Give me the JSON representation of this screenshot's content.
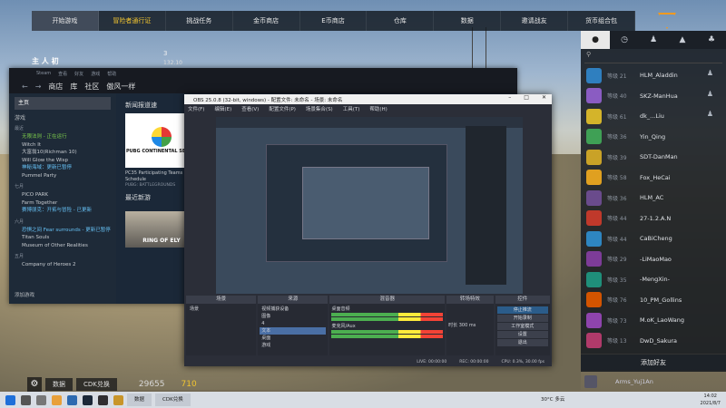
{
  "game_nav": {
    "tabs": [
      "开始游戏",
      "冒险者通行证",
      "挑战任务",
      "金币商店",
      "E币商店",
      "仓库",
      "数据",
      "邀请战友",
      "货币组合包"
    ]
  },
  "hud": {
    "left_label": "主 人 初",
    "top_value": "132.10",
    "top_sub": "3"
  },
  "friends": {
    "tabs": [
      "person-icon",
      "clock-icon",
      "add-person-icon",
      "group-icon",
      "people-icon"
    ],
    "search_placeholder": "",
    "list": [
      {
        "level": "等级 21",
        "name": "HLM_Aladdin",
        "badge": true,
        "color": "#2f7fbf"
      },
      {
        "level": "等级 40",
        "name": "SKZ-ManHua",
        "badge": true,
        "color": "#8a5cc2"
      },
      {
        "level": "等级 61",
        "name": "dk_...Liu",
        "badge": true,
        "color": "#d4b42a"
      },
      {
        "level": "等级 36",
        "name": "Yin_Qing",
        "badge": false,
        "color": "#3fa055"
      },
      {
        "level": "等级 39",
        "name": "SDT-DanMan",
        "badge": false,
        "color": "#c9a227"
      },
      {
        "level": "等级 58",
        "name": "Fox_HeCai",
        "badge": false,
        "color": "#e0a020"
      },
      {
        "level": "等级 36",
        "name": "HLM_AC",
        "badge": false,
        "color": "#6a4b8c"
      },
      {
        "level": "等级 44",
        "name": "27-1.2.A.N",
        "badge": false,
        "color": "#c0392b"
      },
      {
        "level": "等级 44",
        "name": "CaBiCheng",
        "badge": false,
        "color": "#2e86c1"
      },
      {
        "level": "等级 29",
        "name": "-LiMaoMao",
        "badge": false,
        "color": "#7d3c98"
      },
      {
        "level": "等级 35",
        "name": "-MengXin-",
        "badge": false,
        "color": "#1f8f7a"
      },
      {
        "level": "等级 76",
        "name": "10_PM_Gollins",
        "badge": false,
        "color": "#d35400"
      },
      {
        "level": "等级 73",
        "name": "M.oK_LaoWang",
        "badge": false,
        "color": "#8e44ad"
      },
      {
        "level": "等级 13",
        "name": "DwD_Sakura",
        "badge": false,
        "color": "#b03a6a"
      }
    ],
    "add_friend": "添加好友",
    "me_name": "Arms_Yuj1An"
  },
  "game_bottom": {
    "btn1": "数据",
    "btn2": "CDK兑换",
    "coins": "29655",
    "gold": "710"
  },
  "steam": {
    "menu": [
      "Steam",
      "查看",
      "好友",
      "游戏",
      "帮助"
    ],
    "nav": [
      "商店",
      "库",
      "社区",
      "傲风一样"
    ],
    "home": "主页",
    "games_label": "游戏",
    "recent_label": "最近",
    "recent_games": [
      "无限法则 - 正在运行",
      "Witch It",
      "大富翁10(Richman 10)",
      "Will Glow the Wisp",
      "神秘海域：更新已暂停",
      "Pummel Party"
    ],
    "friends_label": "七月",
    "july_games": [
      "PICO PARK",
      "Farm Together",
      "赛博朋克：开拓与冒险 - 已更新"
    ],
    "june_label": "六月",
    "june_games": [
      "恐惧之间 Fear surrounds - 更新已暂停",
      "Titan Souls",
      "Museum of Other Realities"
    ],
    "may_label": "五月",
    "may_games": [
      "Company of Heroes 2"
    ],
    "add_game": "添加游戏",
    "news_header": "新闻报道速",
    "news_text": "PC35 Participating Teams Schedule",
    "news_source": "PUBG: BATTLEGROUNDS",
    "pubg_logo_text": "PUBG CONTINENTAL SERIES",
    "recent_header": "最近新游",
    "ring_text": "RING OF ELY"
  },
  "obs": {
    "title": "OBS 25.0.8 (32-bit, windows) - 配置文件: 未命名 - 场景: 未命名",
    "menu": [
      "文件(F)",
      "编辑(E)",
      "查看(V)",
      "配置文件(P)",
      "场景集合(S)",
      "工具(T)",
      "帮助(H)"
    ],
    "docks": {
      "scenes": "场景",
      "sources": "来源",
      "mixer": "混音器",
      "transitions": "转场特效",
      "controls": "控件"
    },
    "scene_items": [
      "场景"
    ],
    "source_items": [
      "视频捕获设备",
      "图像",
      "4",
      "文本",
      "桌面",
      "游戏"
    ],
    "mixer_items": [
      "桌面音频",
      "麦克风/Aux"
    ],
    "transition": {
      "label": "时长",
      "value": "300 ms"
    },
    "controls": [
      "停止推流",
      "开始录制",
      "工作室模式",
      "设置",
      "退出"
    ],
    "status": {
      "live": "LIVE: 00:00:00",
      "rec": "REC: 00:00:00",
      "cpu": "CPU: 0.3%, 30.00 fps"
    }
  },
  "taskbar": {
    "apps": [
      "数据",
      "CDK兑换"
    ],
    "weather": "30°C 多云",
    "time": "14:02",
    "date": "2021/8/7"
  }
}
